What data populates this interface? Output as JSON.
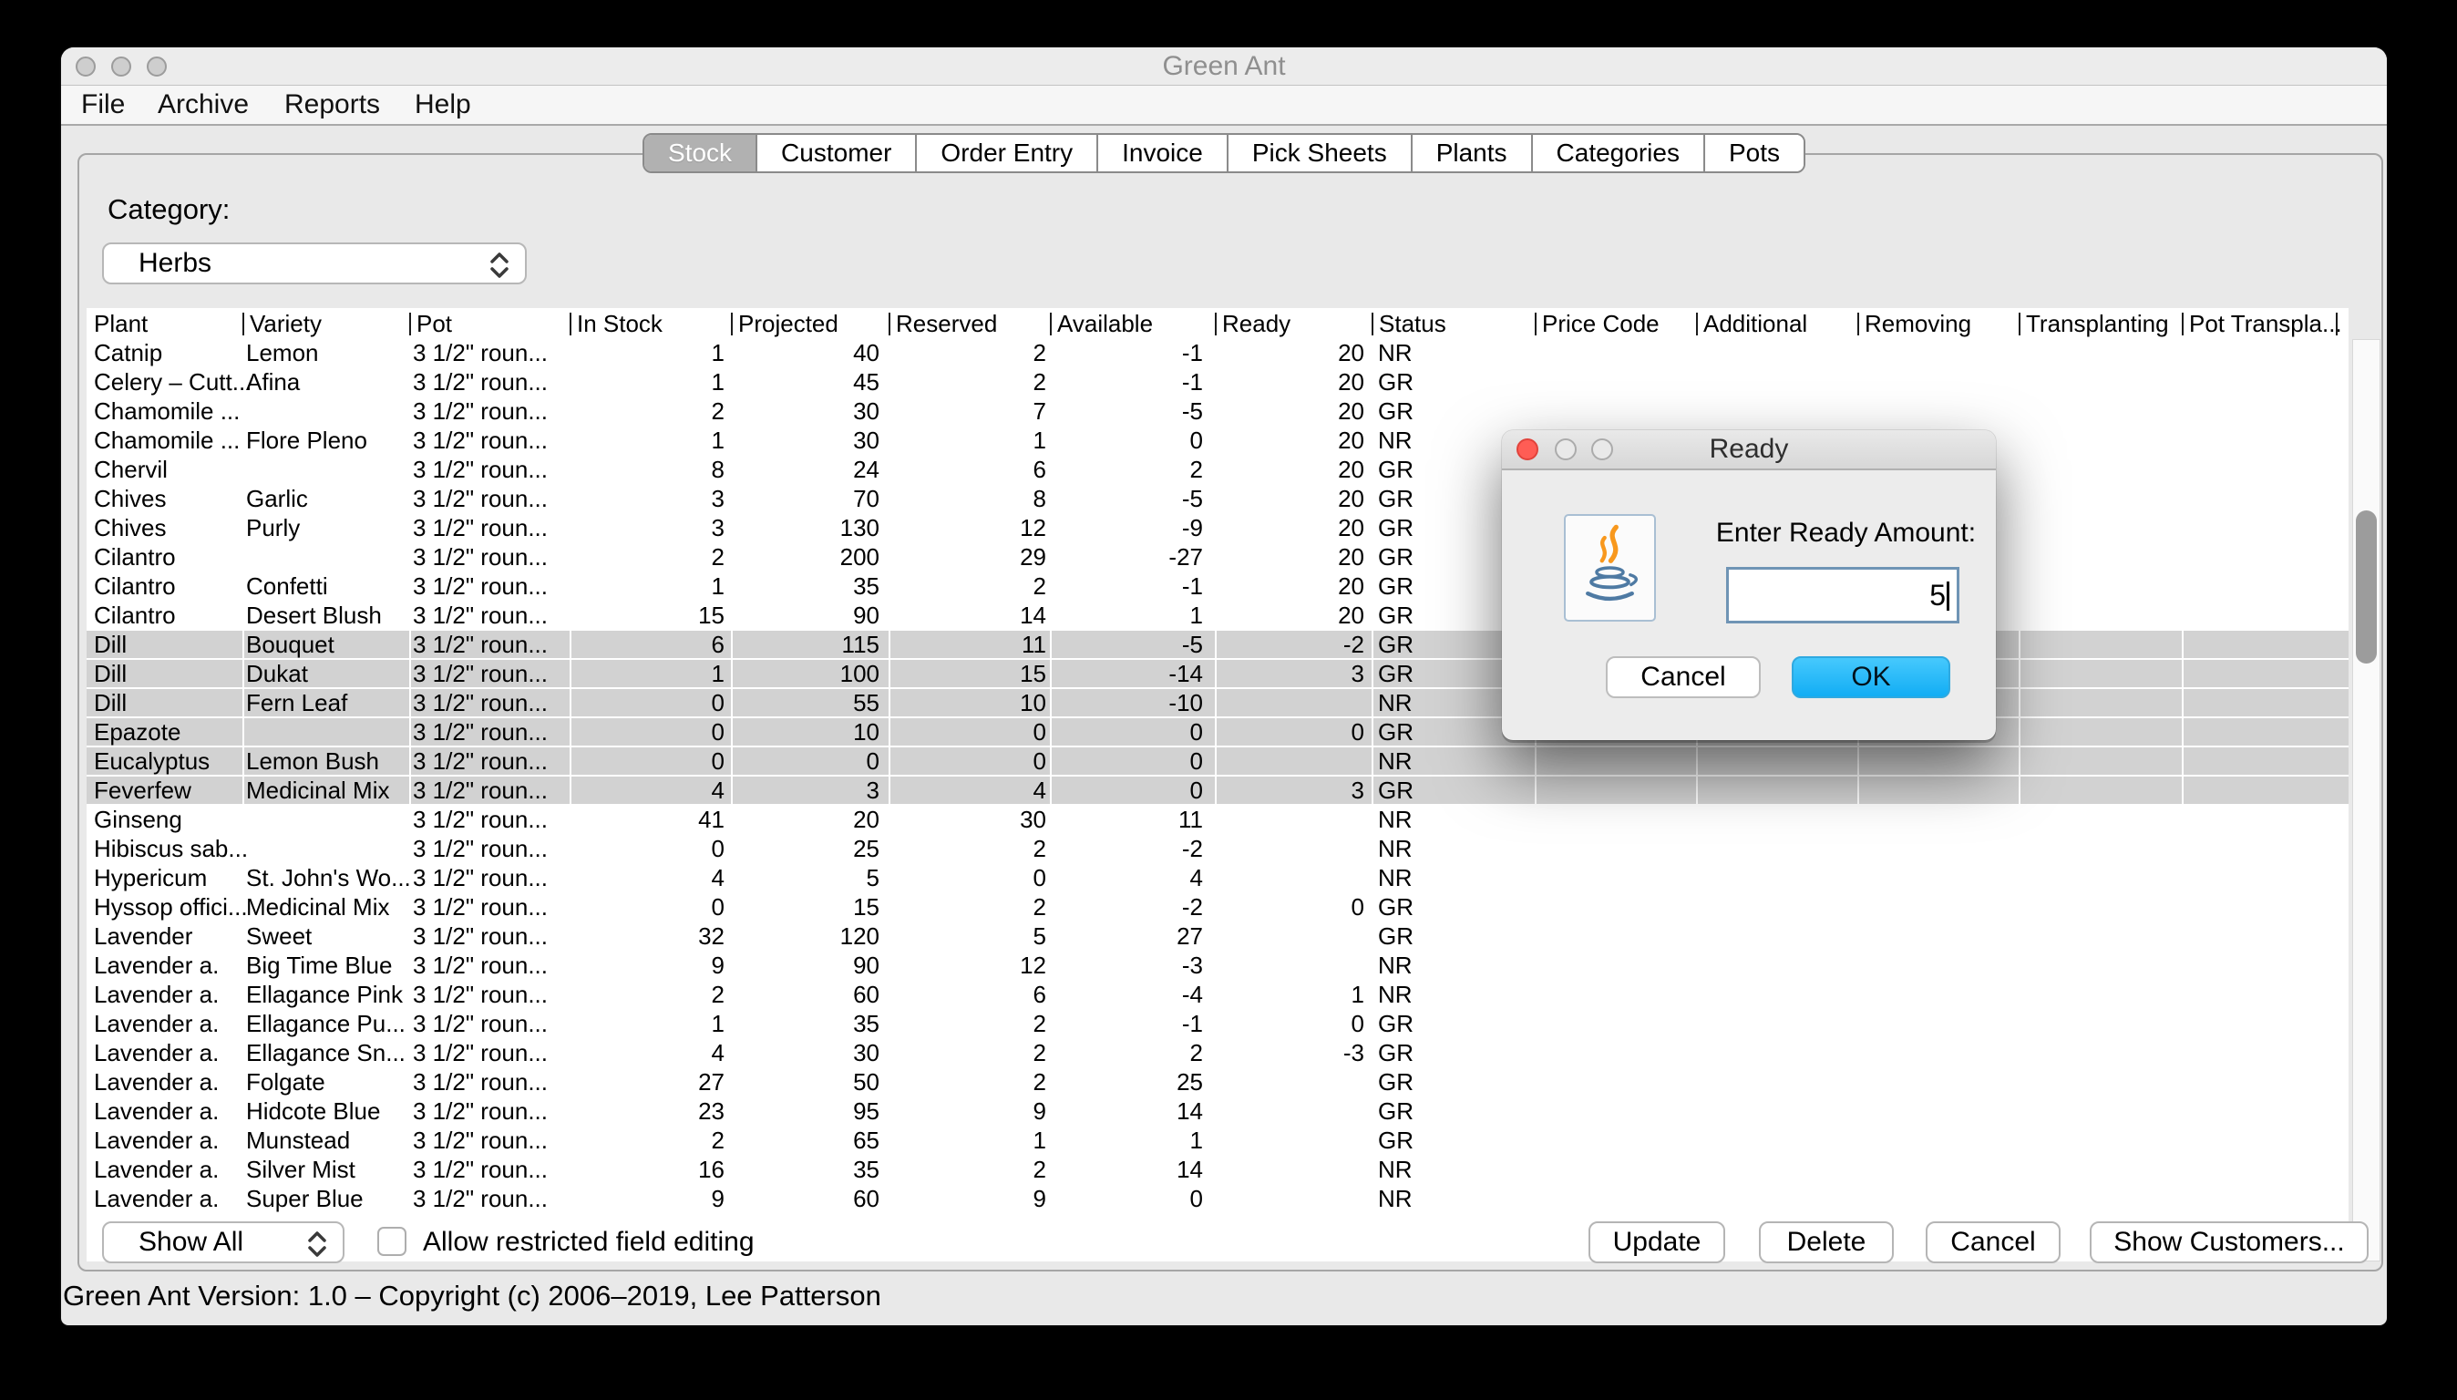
{
  "window": {
    "title": "Green Ant"
  },
  "menu_bar": {
    "items": [
      "File",
      "Archive",
      "Reports",
      "Help"
    ]
  },
  "tab_bar": {
    "tabs": [
      "Stock",
      "Customer",
      "Order Entry",
      "Invoice",
      "Pick Sheets",
      "Plants",
      "Categories",
      "Pots"
    ],
    "selected_tab": "Stock"
  },
  "filter_section": {
    "category_label": "Category:",
    "category_value": "Herbs"
  },
  "stock_table": {
    "columns": [
      "Plant",
      "Variety",
      "Pot",
      "In Stock",
      "Projected",
      "Reserved",
      "Available",
      "Ready",
      "Status",
      "Price Code",
      "Additional",
      "Removing",
      "Transplanting",
      "Pot Transpla..."
    ],
    "rows": [
      {
        "plant": "Catnip",
        "variety": "Lemon",
        "pot": "3 1/2\" roun...",
        "in_stock": "1",
        "projected": "40",
        "reserved": "2",
        "available": "-1",
        "ready": "20",
        "status": "NR",
        "selected": false
      },
      {
        "plant": "Celery – Cutt...",
        "variety": "Afina",
        "pot": "3 1/2\" roun...",
        "in_stock": "1",
        "projected": "45",
        "reserved": "2",
        "available": "-1",
        "ready": "20",
        "status": "GR",
        "selected": false
      },
      {
        "plant": "Chamomile ...",
        "variety": "",
        "pot": "3 1/2\" roun...",
        "in_stock": "2",
        "projected": "30",
        "reserved": "7",
        "available": "-5",
        "ready": "20",
        "status": "GR",
        "selected": false
      },
      {
        "plant": "Chamomile ...",
        "variety": "Flore Pleno",
        "pot": "3 1/2\" roun...",
        "in_stock": "1",
        "projected": "30",
        "reserved": "1",
        "available": "0",
        "ready": "20",
        "status": "NR",
        "selected": false
      },
      {
        "plant": "Chervil",
        "variety": "",
        "pot": "3 1/2\" roun...",
        "in_stock": "8",
        "projected": "24",
        "reserved": "6",
        "available": "2",
        "ready": "20",
        "status": "GR",
        "selected": false
      },
      {
        "plant": "Chives",
        "variety": "Garlic",
        "pot": "3 1/2\" roun...",
        "in_stock": "3",
        "projected": "70",
        "reserved": "8",
        "available": "-5",
        "ready": "20",
        "status": "GR",
        "selected": false
      },
      {
        "plant": "Chives",
        "variety": "Purly",
        "pot": "3 1/2\" roun...",
        "in_stock": "3",
        "projected": "130",
        "reserved": "12",
        "available": "-9",
        "ready": "20",
        "status": "GR",
        "selected": false
      },
      {
        "plant": "Cilantro",
        "variety": "",
        "pot": "3 1/2\" roun...",
        "in_stock": "2",
        "projected": "200",
        "reserved": "29",
        "available": "-27",
        "ready": "20",
        "status": "GR",
        "selected": false
      },
      {
        "plant": "Cilantro",
        "variety": "Confetti",
        "pot": "3 1/2\" roun...",
        "in_stock": "1",
        "projected": "35",
        "reserved": "2",
        "available": "-1",
        "ready": "20",
        "status": "GR",
        "selected": false
      },
      {
        "plant": "Cilantro",
        "variety": "Desert Blush",
        "pot": "3 1/2\" roun...",
        "in_stock": "15",
        "projected": "90",
        "reserved": "14",
        "available": "1",
        "ready": "20",
        "status": "GR",
        "selected": false
      },
      {
        "plant": "Dill",
        "variety": "Bouquet",
        "pot": "3 1/2\" roun...",
        "in_stock": "6",
        "projected": "115",
        "reserved": "11",
        "available": "-5",
        "ready": "-2",
        "status": "GR",
        "selected": true
      },
      {
        "plant": "Dill",
        "variety": "Dukat",
        "pot": "3 1/2\" roun...",
        "in_stock": "1",
        "projected": "100",
        "reserved": "15",
        "available": "-14",
        "ready": "3",
        "status": "GR",
        "selected": true
      },
      {
        "plant": "Dill",
        "variety": "Fern Leaf",
        "pot": "3 1/2\" roun...",
        "in_stock": "0",
        "projected": "55",
        "reserved": "10",
        "available": "-10",
        "ready": "",
        "status": "NR",
        "selected": true
      },
      {
        "plant": "Epazote",
        "variety": "",
        "pot": "3 1/2\" roun...",
        "in_stock": "0",
        "projected": "10",
        "reserved": "0",
        "available": "0",
        "ready": "0",
        "status": "GR",
        "selected": true
      },
      {
        "plant": "Eucalyptus",
        "variety": "Lemon Bush",
        "pot": "3 1/2\" roun...",
        "in_stock": "0",
        "projected": "0",
        "reserved": "0",
        "available": "0",
        "ready": "",
        "status": "NR",
        "selected": true
      },
      {
        "plant": "Feverfew",
        "variety": "Medicinal Mix",
        "pot": "3 1/2\" roun...",
        "in_stock": "4",
        "projected": "3",
        "reserved": "4",
        "available": "0",
        "ready": "3",
        "status": "GR",
        "selected": true
      },
      {
        "plant": "Ginseng",
        "variety": "",
        "pot": "3 1/2\" roun...",
        "in_stock": "41",
        "projected": "20",
        "reserved": "30",
        "available": "11",
        "ready": "",
        "status": "NR",
        "selected": false
      },
      {
        "plant": "Hibiscus sab...",
        "variety": "",
        "pot": "3 1/2\" roun...",
        "in_stock": "0",
        "projected": "25",
        "reserved": "2",
        "available": "-2",
        "ready": "",
        "status": "NR",
        "selected": false
      },
      {
        "plant": "Hypericum",
        "variety": "St. John's Wo...",
        "pot": "3 1/2\" roun...",
        "in_stock": "4",
        "projected": "5",
        "reserved": "0",
        "available": "4",
        "ready": "",
        "status": "NR",
        "selected": false
      },
      {
        "plant": "Hyssop offici...",
        "variety": "Medicinal Mix",
        "pot": "3 1/2\" roun...",
        "in_stock": "0",
        "projected": "15",
        "reserved": "2",
        "available": "-2",
        "ready": "0",
        "status": "GR",
        "selected": false
      },
      {
        "plant": "Lavender",
        "variety": "Sweet",
        "pot": "3 1/2\" roun...",
        "in_stock": "32",
        "projected": "120",
        "reserved": "5",
        "available": "27",
        "ready": "",
        "status": "GR",
        "selected": false
      },
      {
        "plant": "Lavender a.",
        "variety": "Big Time Blue",
        "pot": "3 1/2\" roun...",
        "in_stock": "9",
        "projected": "90",
        "reserved": "12",
        "available": "-3",
        "ready": "",
        "status": "NR",
        "selected": false
      },
      {
        "plant": "Lavender a.",
        "variety": "Ellagance Pink",
        "pot": "3 1/2\" roun...",
        "in_stock": "2",
        "projected": "60",
        "reserved": "6",
        "available": "-4",
        "ready": "1",
        "status": "NR",
        "selected": false
      },
      {
        "plant": "Lavender a.",
        "variety": "Ellagance Pu...",
        "pot": "3 1/2\" roun...",
        "in_stock": "1",
        "projected": "35",
        "reserved": "2",
        "available": "-1",
        "ready": "0",
        "status": "GR",
        "selected": false
      },
      {
        "plant": "Lavender a.",
        "variety": "Ellagance Sn...",
        "pot": "3 1/2\" roun...",
        "in_stock": "4",
        "projected": "30",
        "reserved": "2",
        "available": "2",
        "ready": "-3",
        "status": "GR",
        "selected": false
      },
      {
        "plant": "Lavender a.",
        "variety": "Folgate",
        "pot": "3 1/2\" roun...",
        "in_stock": "27",
        "projected": "50",
        "reserved": "2",
        "available": "25",
        "ready": "",
        "status": "GR",
        "selected": false
      },
      {
        "plant": "Lavender a.",
        "variety": "Hidcote Blue",
        "pot": "3 1/2\" roun...",
        "in_stock": "23",
        "projected": "95",
        "reserved": "9",
        "available": "14",
        "ready": "",
        "status": "GR",
        "selected": false
      },
      {
        "plant": "Lavender a.",
        "variety": "Munstead",
        "pot": "3 1/2\" roun...",
        "in_stock": "2",
        "projected": "65",
        "reserved": "1",
        "available": "1",
        "ready": "",
        "status": "GR",
        "selected": false
      },
      {
        "plant": "Lavender a.",
        "variety": "Silver Mist",
        "pot": "3 1/2\" roun...",
        "in_stock": "16",
        "projected": "35",
        "reserved": "2",
        "available": "14",
        "ready": "",
        "status": "NR",
        "selected": false
      },
      {
        "plant": "Lavender a.",
        "variety": "Super Blue",
        "pot": "3 1/2\" roun...",
        "in_stock": "9",
        "projected": "60",
        "reserved": "9",
        "available": "0",
        "ready": "",
        "status": "NR",
        "selected": false
      }
    ]
  },
  "ready_dialog": {
    "title": "Ready",
    "prompt": "Enter Ready Amount:",
    "input_value": "5",
    "cancel_label": "Cancel",
    "ok_label": "OK",
    "icon": "java-coffee-cup-icon",
    "ok_color": "#29b6f6"
  },
  "footer": {
    "filter_value": "Show All",
    "checkbox_label": "Allow restricted field editing",
    "checkbox_checked": false,
    "buttons": [
      "Update",
      "Delete",
      "Cancel",
      "Show Customers..."
    ]
  },
  "status_bar": {
    "text": "Green Ant Version: 1.0 – Copyright (c) 2006–2019, Lee Patterson"
  }
}
